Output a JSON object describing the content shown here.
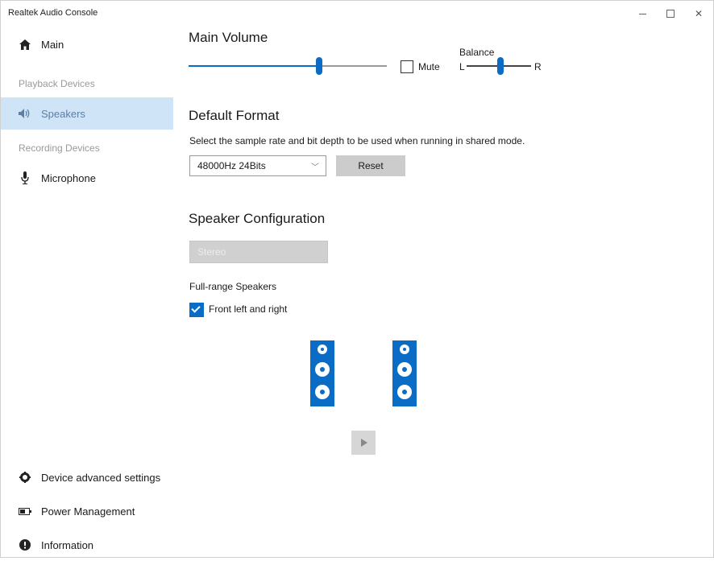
{
  "window": {
    "title": "Realtek Audio Console"
  },
  "sidebar": {
    "main_label": "Main",
    "playback_header": "Playback Devices",
    "speakers_label": "Speakers",
    "recording_header": "Recording Devices",
    "microphone_label": "Microphone",
    "device_advanced_label": "Device advanced settings",
    "power_label": "Power Management",
    "information_label": "Information"
  },
  "main_volume": {
    "title": "Main Volume",
    "volume_level": 0.66,
    "mute_label": "Mute",
    "mute_checked": false,
    "balance_label": "Balance",
    "balance_left": "L",
    "balance_right": "R",
    "balance_position": 0.53
  },
  "default_format": {
    "title": "Default Format",
    "description": "Select the sample rate and bit depth to be used when running in shared mode.",
    "selected": "48000Hz 24Bits",
    "reset_label": "Reset"
  },
  "speaker_config": {
    "title": "Speaker Configuration",
    "selected": "Stereo",
    "full_range_label": "Full-range Speakers",
    "front_lr_label": "Front left and right",
    "front_lr_checked": true
  },
  "colors": {
    "accent": "#0a6cc4",
    "selected_bg": "#cfe4f7"
  }
}
